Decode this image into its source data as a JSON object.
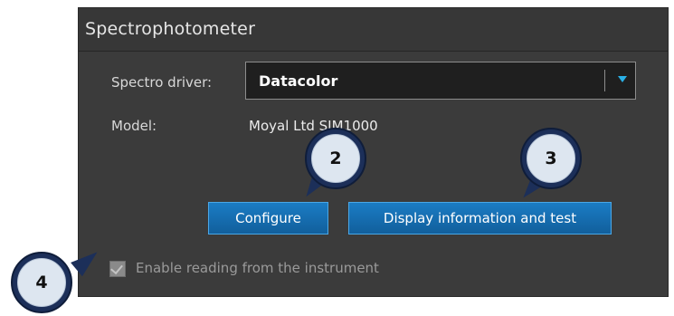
{
  "window": {
    "title": "Spectrophotometer"
  },
  "form": {
    "spectro_driver_label": "Spectro driver:",
    "spectro_driver_value": "Datacolor",
    "model_label": "Model:",
    "model_value": "Moyal Ltd SIM1000"
  },
  "buttons": {
    "configure_label": "Configure",
    "display_label": "Display information and test"
  },
  "checkbox": {
    "label": "Enable reading from the instrument",
    "checked": true,
    "enabled": false
  },
  "callouts": [
    "2",
    "3",
    "4"
  ],
  "colors": {
    "panel_bg": "#3b3b3b",
    "button_blue": "#1b7cc4",
    "dropdown_arrow": "#2ab0e6",
    "callout_ring": "#1c2f59"
  }
}
